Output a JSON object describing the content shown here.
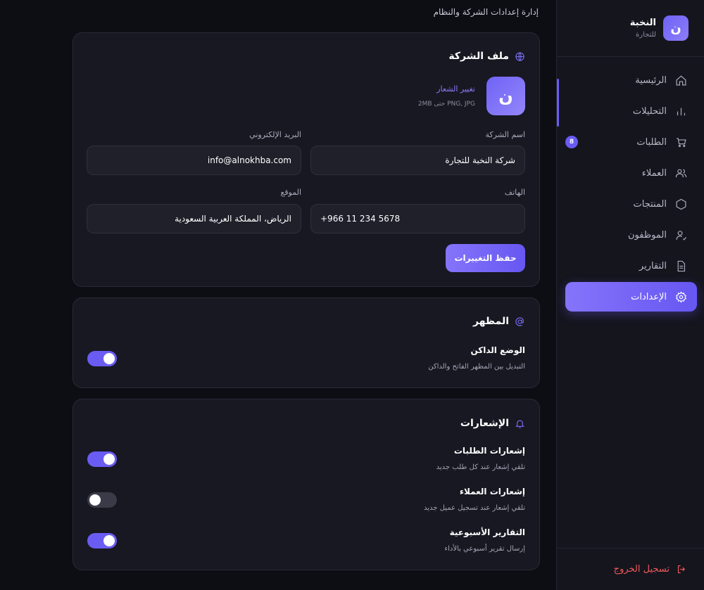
{
  "page": {
    "subtitle": "إدارة إعدادات الشركة والنظام"
  },
  "sidebar": {
    "brand_initial": "ن",
    "brand_name": "النخبة",
    "brand_sub": "للتجارة",
    "items": [
      {
        "label": "الرئيسية",
        "icon": "home-icon"
      },
      {
        "label": "التحليلات",
        "icon": "chart-icon"
      },
      {
        "label": "الطلبات",
        "icon": "cart-icon",
        "badge": "8"
      },
      {
        "label": "العملاء",
        "icon": "users-icon"
      },
      {
        "label": "المنتجات",
        "icon": "box-icon"
      },
      {
        "label": "الموظفون",
        "icon": "user-check-icon"
      },
      {
        "label": "التقارير",
        "icon": "document-icon"
      },
      {
        "label": "الإعدادات",
        "icon": "gear-icon",
        "active": true
      }
    ],
    "logout_label": "تسجيل الخروج"
  },
  "company_profile": {
    "title": "ملف الشركة",
    "logo_initial": "ن",
    "change_logo": "تغيير الشعار",
    "logo_hint": "PNG, JPG حتى 2MB",
    "fields": {
      "company_name_label": "اسم الشركة",
      "company_name_value": "شركة النخبة للتجارة",
      "email_label": "البريد الإلكتروني",
      "email_value": "info@alnokhba.com",
      "phone_label": "الهاتف",
      "phone_value": "+966 11 234 5678",
      "location_label": "الموقع",
      "location_value": "الرياض، المملكة العربية السعودية"
    },
    "save_label": "حفظ التغييرات"
  },
  "appearance": {
    "title": "المظهر",
    "dark_mode_title": "الوضع الداكن",
    "dark_mode_desc": "التبديل بين المظهر الفاتح والداكن",
    "dark_mode_on": true
  },
  "notifications": {
    "title": "الإشعارات",
    "items": [
      {
        "title": "إشعارات الطلبات",
        "desc": "تلقي إشعار عند كل طلب جديد",
        "on": true
      },
      {
        "title": "إشعارات العملاء",
        "desc": "تلقي إشعار عند تسجيل عميل جديد",
        "on": false
      },
      {
        "title": "التقارير الأسبوعية",
        "desc": "إرسال تقرير أسبوعي بالأداء",
        "on": true
      }
    ]
  },
  "colors": {
    "accent": "#6a5cf3",
    "danger": "#f05a5a",
    "background": "#0d0d14",
    "card": "#181822"
  }
}
